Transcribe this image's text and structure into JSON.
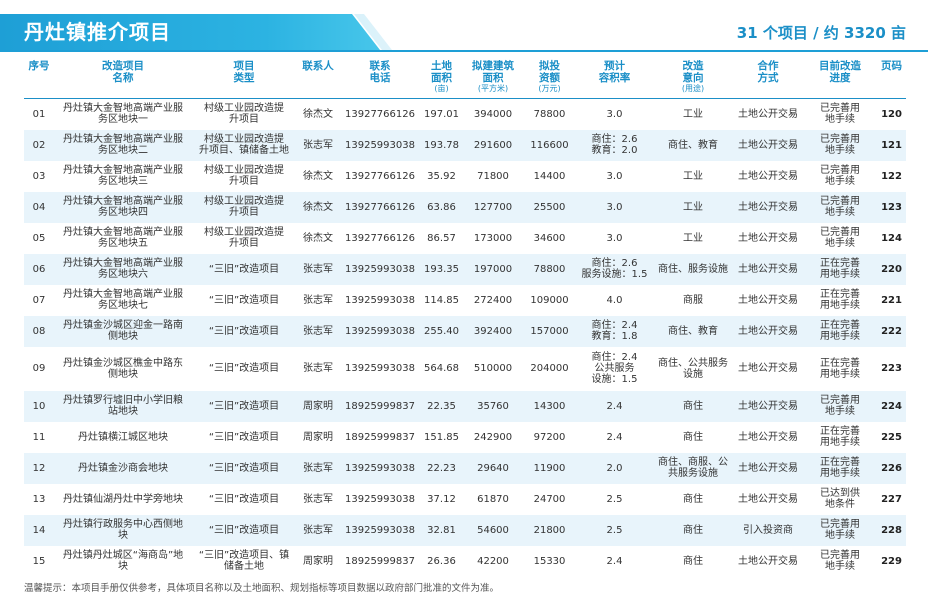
{
  "header": {
    "title": "丹灶镇推介项目",
    "summary": "31 个项目 / 约 3320 亩"
  },
  "columns": [
    {
      "label": "序号",
      "sub": ""
    },
    {
      "label": "改造项目\n名称",
      "sub": ""
    },
    {
      "label": "项目\n类型",
      "sub": ""
    },
    {
      "label": "联系人",
      "sub": ""
    },
    {
      "label": "联系\n电话",
      "sub": ""
    },
    {
      "label": "土地\n面积",
      "sub": "(亩)"
    },
    {
      "label": "拟建建筑\n面积",
      "sub": "(平方米)"
    },
    {
      "label": "拟投\n资额",
      "sub": "(万元)"
    },
    {
      "label": "预计\n容积率",
      "sub": ""
    },
    {
      "label": "改造\n意向",
      "sub": "(用途)"
    },
    {
      "label": "合作\n方式",
      "sub": ""
    },
    {
      "label": "目前改造\n进度",
      "sub": ""
    },
    {
      "label": "页码",
      "sub": ""
    }
  ],
  "rows": [
    {
      "no": "01",
      "name": "丹灶镇大金智地高端产业服\n务区地块一",
      "type": "村级工业园改造提\n升项目",
      "contact": "徐杰文",
      "phone": "13927766126",
      "area": "197.01",
      "build": "394000",
      "invest": "78800",
      "far": "3.0",
      "use": "工业",
      "coop": "土地公开交易",
      "progress": "已完善用\n地手续",
      "page": "120"
    },
    {
      "no": "02",
      "name": "丹灶镇大金智地高端产业服\n务区地块二",
      "type": "村级工业园改造提\n升项目、镇储备土地",
      "contact": "张志军",
      "phone": "13925993038",
      "area": "193.78",
      "build": "291600",
      "invest": "116600",
      "far": "商住：2.6\n教育：2.0",
      "use": "商住、教育",
      "coop": "土地公开交易",
      "progress": "已完善用\n地手续",
      "page": "121"
    },
    {
      "no": "03",
      "name": "丹灶镇大金智地高端产业服\n务区地块三",
      "type": "村级工业园改造提\n升项目",
      "contact": "徐杰文",
      "phone": "13927766126",
      "area": "35.92",
      "build": "71800",
      "invest": "14400",
      "far": "3.0",
      "use": "工业",
      "coop": "土地公开交易",
      "progress": "已完善用\n地手续",
      "page": "122"
    },
    {
      "no": "04",
      "name": "丹灶镇大金智地高端产业服\n务区地块四",
      "type": "村级工业园改造提\n升项目",
      "contact": "徐杰文",
      "phone": "13927766126",
      "area": "63.86",
      "build": "127700",
      "invest": "25500",
      "far": "3.0",
      "use": "工业",
      "coop": "土地公开交易",
      "progress": "已完善用\n地手续",
      "page": "123"
    },
    {
      "no": "05",
      "name": "丹灶镇大金智地高端产业服\n务区地块五",
      "type": "村级工业园改造提\n升项目",
      "contact": "徐杰文",
      "phone": "13927766126",
      "area": "86.57",
      "build": "173000",
      "invest": "34600",
      "far": "3.0",
      "use": "工业",
      "coop": "土地公开交易",
      "progress": "已完善用\n地手续",
      "page": "124"
    },
    {
      "no": "06",
      "name": "丹灶镇大金智地高端产业服\n务区地块六",
      "type": "“三旧”改造项目",
      "contact": "张志军",
      "phone": "13925993038",
      "area": "193.35",
      "build": "197000",
      "invest": "78800",
      "far": "商住：2.6\n服务设施：1.5",
      "use": "商住、服务设施",
      "coop": "土地公开交易",
      "progress": "正在完善\n用地手续",
      "page": "220"
    },
    {
      "no": "07",
      "name": "丹灶镇大金智地高端产业服\n务区地块七",
      "type": "“三旧”改造项目",
      "contact": "张志军",
      "phone": "13925993038",
      "area": "114.85",
      "build": "272400",
      "invest": "109000",
      "far": "4.0",
      "use": "商服",
      "coop": "土地公开交易",
      "progress": "正在完善\n用地手续",
      "page": "221"
    },
    {
      "no": "08",
      "name": "丹灶镇金沙城区迎金一路南\n侧地块",
      "type": "“三旧”改造项目",
      "contact": "张志军",
      "phone": "13925993038",
      "area": "255.40",
      "build": "392400",
      "invest": "157000",
      "far": "商住：2.4\n教育：1.8",
      "use": "商住、教育",
      "coop": "土地公开交易",
      "progress": "正在完善\n用地手续",
      "page": "222"
    },
    {
      "no": "09",
      "name": "丹灶镇金沙城区樵金中路东\n侧地块",
      "type": "“三旧”改造项目",
      "contact": "张志军",
      "phone": "13925993038",
      "area": "564.68",
      "build": "510000",
      "invest": "204000",
      "far": "商住：2.4\n公共服务\n设施：1.5",
      "use": "商住、公共服务\n设施",
      "coop": "土地公开交易",
      "progress": "正在完善\n用地手续",
      "page": "223"
    },
    {
      "no": "10",
      "name": "丹灶镇罗行墟旧中小学旧粮\n站地块",
      "type": "“三旧”改造项目",
      "contact": "周家明",
      "phone": "18925999837",
      "area": "22.35",
      "build": "35760",
      "invest": "14300",
      "far": "2.4",
      "use": "商住",
      "coop": "土地公开交易",
      "progress": "已完善用\n地手续",
      "page": "224"
    },
    {
      "no": "11",
      "name": "丹灶镇横江城区地块",
      "type": "“三旧”改造项目",
      "contact": "周家明",
      "phone": "18925999837",
      "area": "151.85",
      "build": "242900",
      "invest": "97200",
      "far": "2.4",
      "use": "商住",
      "coop": "土地公开交易",
      "progress": "正在完善\n用地手续",
      "page": "225"
    },
    {
      "no": "12",
      "name": "丹灶镇金沙商会地块",
      "type": "“三旧”改造项目",
      "contact": "张志军",
      "phone": "13925993038",
      "area": "22.23",
      "build": "29640",
      "invest": "11900",
      "far": "2.0",
      "use": "商住、商服、公\n共服务设施",
      "coop": "土地公开交易",
      "progress": "正在完善\n用地手续",
      "page": "226"
    },
    {
      "no": "13",
      "name": "丹灶镇仙湖丹灶中学旁地块",
      "type": "“三旧”改造项目",
      "contact": "张志军",
      "phone": "13925993038",
      "area": "37.12",
      "build": "61870",
      "invest": "24700",
      "far": "2.5",
      "use": "商住",
      "coop": "土地公开交易",
      "progress": "已达到供\n地条件",
      "page": "227"
    },
    {
      "no": "14",
      "name": "丹灶镇行政服务中心西侧地\n块",
      "type": "“三旧”改造项目",
      "contact": "张志军",
      "phone": "13925993038",
      "area": "32.81",
      "build": "54600",
      "invest": "21800",
      "far": "2.5",
      "use": "商住",
      "coop": "引入投资商",
      "progress": "已完善用\n地手续",
      "page": "228"
    },
    {
      "no": "15",
      "name": "丹灶镇丹灶城区“海商岛”地\n块",
      "type": "“三旧”改造项目、镇\n储备土地",
      "contact": "周家明",
      "phone": "18925999837",
      "area": "26.36",
      "build": "42200",
      "invest": "15330",
      "far": "2.4",
      "use": "商住",
      "coop": "土地公开交易",
      "progress": "已完善用\n地手续",
      "page": "229"
    }
  ],
  "footer": {
    "note": "温馨提示：本项目手册仅供参考，具体项目名称以及土地面积、规划指标等项目数据以政府部门批准的文件为准。"
  }
}
